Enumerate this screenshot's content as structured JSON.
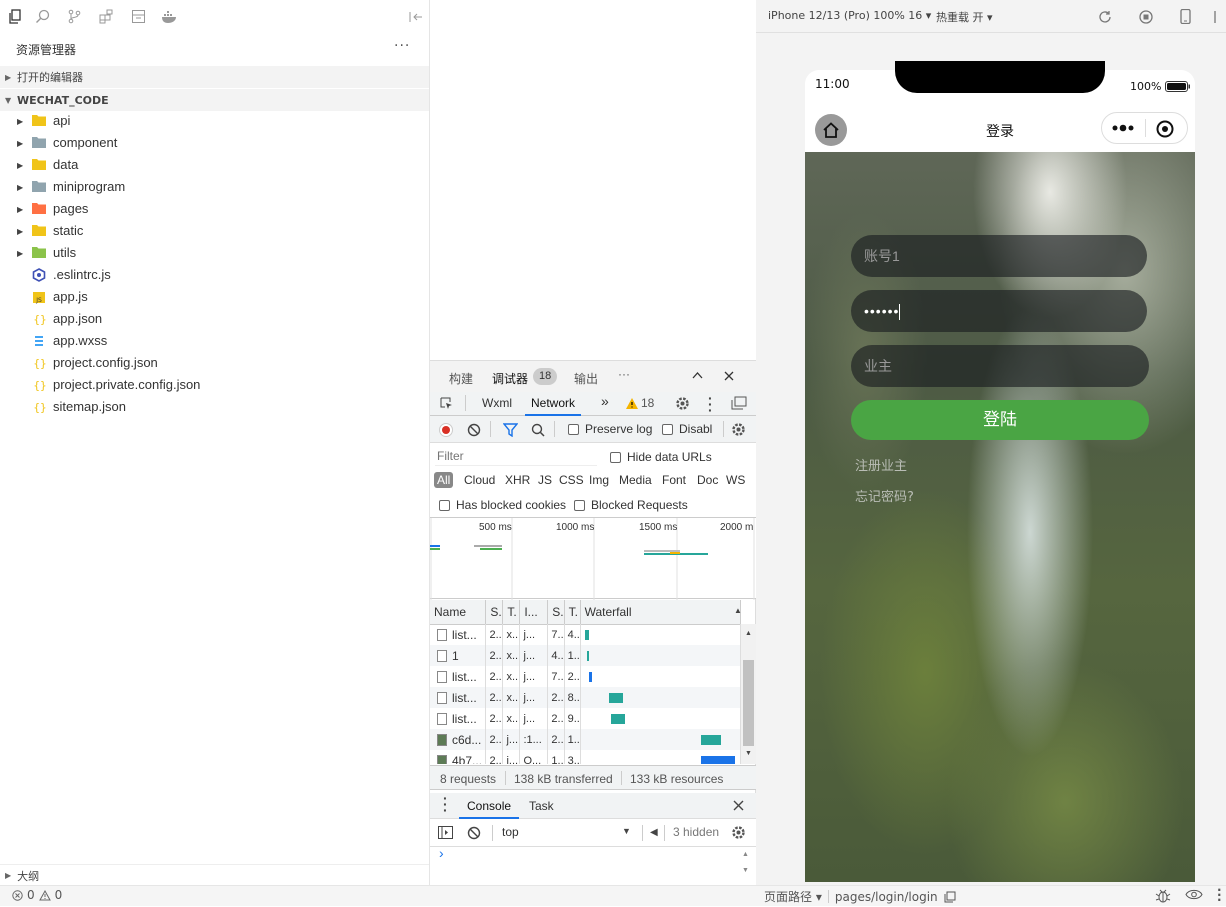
{
  "explorer": {
    "title": "资源管理器",
    "more": "···",
    "open_editors": "打开的编辑器",
    "project": "WECHAT_CODE",
    "outline": "大纲",
    "items": [
      {
        "label": "api",
        "type": "folder",
        "color": "#f0c419",
        "icon": "folder-api-icon"
      },
      {
        "label": "component",
        "type": "folder",
        "color": "#90a4ae",
        "icon": "folder-icon"
      },
      {
        "label": "data",
        "type": "folder",
        "color": "#f0c419",
        "icon": "folder-data-icon"
      },
      {
        "label": "miniprogram",
        "type": "folder",
        "color": "#90a4ae",
        "icon": "folder-icon"
      },
      {
        "label": "pages",
        "type": "folder",
        "color": "#ff7043",
        "icon": "folder-pages-icon"
      },
      {
        "label": "static",
        "type": "folder",
        "color": "#f0c419",
        "icon": "folder-static-icon"
      },
      {
        "label": "utils",
        "type": "folder",
        "color": "#8bc34a",
        "icon": "folder-utils-icon"
      },
      {
        "label": ".eslintrc.js",
        "type": "file",
        "color": "#3f51b5",
        "icon": "eslint-icon"
      },
      {
        "label": "app.js",
        "type": "file",
        "color": "#f0c419",
        "icon": "js-file-icon"
      },
      {
        "label": "app.json",
        "type": "file",
        "color": "#f0c419",
        "icon": "json-file-icon"
      },
      {
        "label": "app.wxss",
        "type": "file",
        "color": "#42a5f5",
        "icon": "css-file-icon"
      },
      {
        "label": "project.config.json",
        "type": "file",
        "color": "#f0c419",
        "icon": "json-file-icon"
      },
      {
        "label": "project.private.config.json",
        "type": "file",
        "color": "#f0c419",
        "icon": "json-file-icon"
      },
      {
        "label": "sitemap.json",
        "type": "file",
        "color": "#f0c419",
        "icon": "json-file-icon"
      }
    ]
  },
  "status": {
    "errors": "0",
    "warnings": "0",
    "page_path_label": "页面路径",
    "page_path": "pages/login/login"
  },
  "devtools": {
    "tabs": {
      "build": "构建",
      "debugger": "调试器",
      "badge": "18",
      "output": "输出",
      "more": "···"
    },
    "subtabs": {
      "wxml": "Wxml",
      "network": "Network",
      "more": "»",
      "warn_count": "18"
    },
    "toolbar": {
      "preserve_log": "Preserve log",
      "disable": "Disabl"
    },
    "filter": {
      "placeholder": "Filter",
      "hide_data_urls": "Hide data URLs",
      "types": [
        "All",
        "Cloud",
        "XHR",
        "JS",
        "CSS",
        "Img",
        "Media",
        "Font",
        "Doc",
        "WS"
      ],
      "blocked_cookies": "Has blocked cookies",
      "blocked_requests": "Blocked Requests"
    },
    "timeline": {
      "ticks": [
        "500 ms",
        "1000 ms",
        "1500 ms",
        "2000 m"
      ]
    },
    "table": {
      "headers": [
        "Name",
        "S.",
        "T.",
        "I...",
        "S.",
        "T.",
        "Waterfall"
      ],
      "rows": [
        {
          "name": "list...",
          "c": [
            "2..",
            "x..",
            "j...",
            "7..",
            "4.."
          ]
        },
        {
          "name": "1",
          "c": [
            "2..",
            "x..",
            "j...",
            "4..",
            "1.."
          ]
        },
        {
          "name": "list...",
          "c": [
            "2..",
            "x..",
            "j...",
            "7..",
            "2.."
          ]
        },
        {
          "name": "list...",
          "c": [
            "2..",
            "x..",
            "j...",
            "2..",
            "8.."
          ]
        },
        {
          "name": "list...",
          "c": [
            "2..",
            "x..",
            "j...",
            "2..",
            "9.."
          ]
        },
        {
          "name": "c6d...",
          "c": [
            "2..",
            "j...",
            ":1...",
            "2..",
            "1.."
          ]
        },
        {
          "name": "4b7...",
          "c": [
            "2..",
            "j...",
            "O...",
            "1..",
            "3.."
          ]
        }
      ]
    },
    "summary": {
      "requests": "8 requests",
      "transferred": "138 kB transferred",
      "resources": "133 kB resources"
    },
    "drawer": {
      "console": "Console",
      "task": "Task"
    },
    "console": {
      "context": "top",
      "hidden": "3 hidden",
      "prompt": "›"
    }
  },
  "simulator": {
    "device": "iPhone 12/13 (Pro) 100% 16",
    "hot_reload": "热重载 开",
    "time": "11:00",
    "battery": "100%",
    "nav_title": "登录",
    "login": {
      "account_placeholder": "账号1",
      "password_value": "••••••",
      "role_placeholder": "业主",
      "submit": "登陆",
      "register": "注册业主",
      "forgot": "忘记密码?"
    }
  }
}
